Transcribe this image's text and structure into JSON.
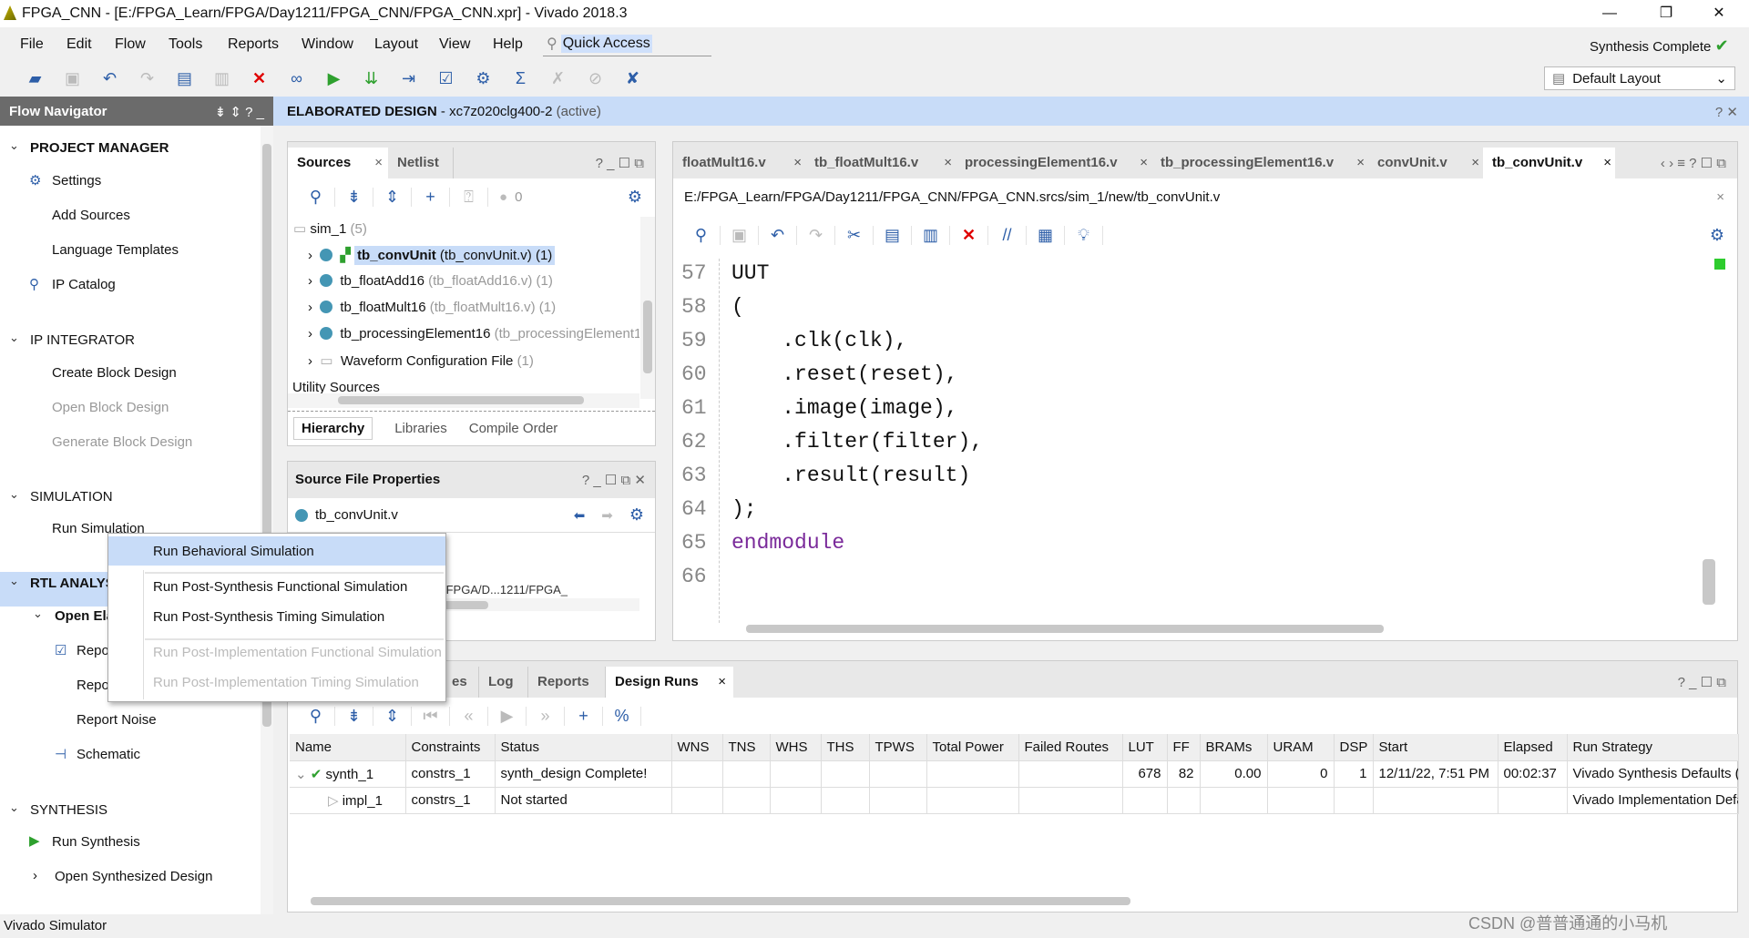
{
  "window": {
    "title": "FPGA_CNN - [E:/FPGA_Learn/FPGA/Day1211/FPGA_CNN/FPGA_CNN.xpr] - Vivado 2018.3",
    "status": "Synthesis Complete"
  },
  "menu": [
    "File",
    "Edit",
    "Flow",
    "Tools",
    "Reports",
    "Window",
    "Layout",
    "View",
    "Help"
  ],
  "quick_access": "Quick Access",
  "layout_select": "Default Layout",
  "flow_navigator": {
    "title": "Flow Navigator",
    "items": [
      {
        "label": "PROJECT MANAGER",
        "type": "section"
      },
      {
        "label": "Settings"
      },
      {
        "label": "Add Sources"
      },
      {
        "label": "Language Templates"
      },
      {
        "label": "IP Catalog"
      },
      {
        "label": "IP INTEGRATOR",
        "type": "section"
      },
      {
        "label": "Create Block Design"
      },
      {
        "label": "Open Block Design",
        "disabled": true
      },
      {
        "label": "Generate Block Design",
        "disabled": true
      },
      {
        "label": "SIMULATION",
        "type": "section"
      },
      {
        "label": "Run Simulation"
      },
      {
        "label": "RTL ANALYSIS",
        "type": "section"
      },
      {
        "label": "Open Elaborated Design"
      },
      {
        "label": "Report Methodology"
      },
      {
        "label": "Report DRC"
      },
      {
        "label": "Report Noise"
      },
      {
        "label": "Schematic"
      },
      {
        "label": "SYNTHESIS",
        "type": "section"
      },
      {
        "label": "Run Synthesis"
      },
      {
        "label": "Open Synthesized Design"
      }
    ]
  },
  "design_header": {
    "title": "ELABORATED DESIGN",
    "part": " - xc7z020clg400-2",
    "state": "(active)"
  },
  "sources": {
    "tabs": [
      "Sources",
      "Netlist"
    ],
    "count": "0",
    "root": "sim_1",
    "root_count": "(5)",
    "items": [
      {
        "name": "tb_convUnit",
        "file": "(tb_convUnit.v) (1)"
      },
      {
        "name": "tb_floatAdd16",
        "file": "(tb_floatAdd16.v) (1)"
      },
      {
        "name": "tb_floatMult16",
        "file": "(tb_floatMult16.v) (1)"
      },
      {
        "name": "tb_processingElement16",
        "file": "(tb_processingElement1"
      },
      {
        "name": "Waveform Configuration File",
        "file": "(1)"
      }
    ],
    "utility": "Utility Sources",
    "bottom_tabs": [
      "Hierarchy",
      "Libraries",
      "Compile Order"
    ]
  },
  "file_props": {
    "title": "Source File Properties",
    "file": "tb_convUnit.v",
    "partial": "/FPGA/D...1211/FPGA_"
  },
  "editor": {
    "tabs": [
      "floatMult16.v",
      "tb_floatMult16.v",
      "processingElement16.v",
      "tb_processingElement16.v",
      "convUnit.v",
      "tb_convUnit.v"
    ],
    "active_tab": 5,
    "path": "E:/FPGA_Learn/FPGA/Day1211/FPGA_CNN/FPGA_CNN.srcs/sim_1/new/tb_convUnit.v",
    "lines": [
      {
        "n": "57",
        "t": "UUT"
      },
      {
        "n": "58",
        "t": "("
      },
      {
        "n": "59",
        "t": "    .clk(clk),"
      },
      {
        "n": "60",
        "t": "    .reset(reset),"
      },
      {
        "n": "61",
        "t": "    .image(image),"
      },
      {
        "n": "62",
        "t": "    .filter(filter),"
      },
      {
        "n": "63",
        "t": "    .result(result)"
      },
      {
        "n": "64",
        "t": ");"
      },
      {
        "n": "65",
        "t": "endmodule"
      },
      {
        "n": "66",
        "t": ""
      }
    ]
  },
  "context_menu": {
    "items": [
      {
        "label": "Run Behavioral Simulation",
        "selected": true
      },
      {
        "label": "Run Post-Synthesis Functional Simulation"
      },
      {
        "label": "Run Post-Synthesis Timing Simulation"
      },
      {
        "label": "Run Post-Implementation Functional Simulation",
        "disabled": true
      },
      {
        "label": "Run Post-Implementation Timing Simulation",
        "disabled": true
      }
    ]
  },
  "bottom": {
    "tabs": [
      "es",
      "Log",
      "Reports",
      "Design Runs"
    ],
    "columns": [
      "Name",
      "Constraints",
      "Status",
      "WNS",
      "TNS",
      "WHS",
      "THS",
      "TPWS",
      "Total Power",
      "Failed Routes",
      "LUT",
      "FF",
      "BRAMs",
      "URAM",
      "DSP",
      "Start",
      "Elapsed",
      "Run Strategy"
    ],
    "rows": [
      [
        "synth_1",
        "constrs_1",
        "synth_design Complete!",
        "",
        "",
        "",
        "",
        "",
        "",
        "",
        "678",
        "82",
        "0.00",
        "0",
        "1",
        "12/11/22, 7:51 PM",
        "00:02:37",
        "Vivado Synthesis Defaults ("
      ],
      [
        "impl_1",
        "constrs_1",
        "Not started",
        "",
        "",
        "",
        "",
        "",
        "",
        "",
        "",
        "",
        "",
        "",
        "",
        "",
        "",
        "Vivado Implementation Defa"
      ]
    ]
  },
  "statusbar": "Vivado Simulator",
  "watermark": "CSDN @普普通通的小马机",
  "colors": {
    "accent": "#2d5ea8",
    "highlight": "#c8dcf8",
    "success": "#2ea02e",
    "error": "#e00000"
  }
}
